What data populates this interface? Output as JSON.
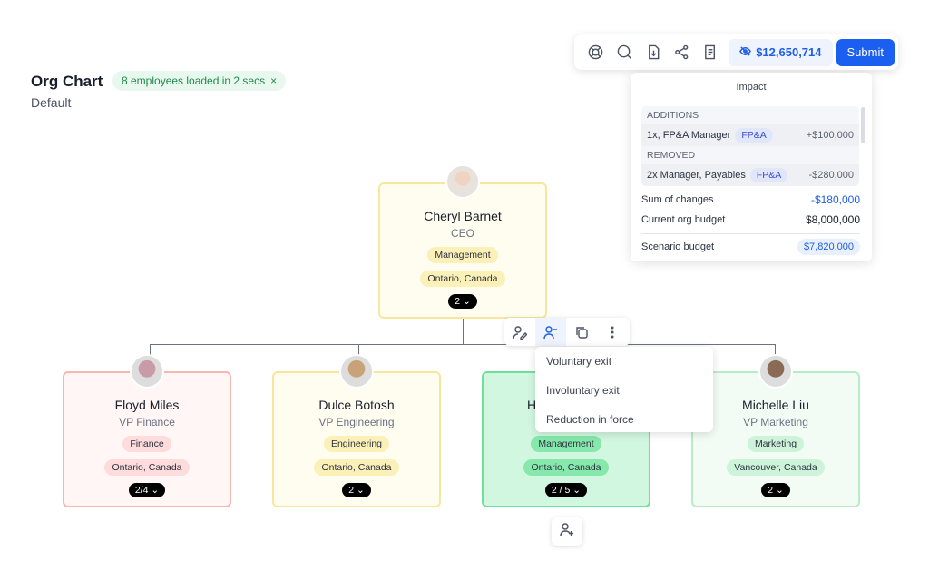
{
  "header": {
    "title": "Org Chart",
    "subtitle": "Default",
    "toast": "8 employees loaded in 2 secs",
    "toast_close": "×"
  },
  "toolbar": {
    "icons": [
      "support-icon",
      "search-icon",
      "download-icon",
      "share-icon",
      "report-icon"
    ],
    "budget": "$12,650,714",
    "submit": "Submit"
  },
  "impact": {
    "title": "Impact",
    "additions_label": "ADDITIONS",
    "additions": [
      {
        "desc": "1x, FP&A Manager",
        "chip": "FP&A",
        "amount": "+$100,000"
      }
    ],
    "removed_label": "REMOVED",
    "removed": [
      {
        "desc": "2x Manager, Payables",
        "chip": "FP&A",
        "amount": "-$280,000"
      }
    ],
    "sum_label": "Sum of changes",
    "sum": "-$180,000",
    "current_label": "Current org budget",
    "current": "$8,000,000",
    "scenario_label": "Scenario budget",
    "scenario": "$7,820,000"
  },
  "ceo": {
    "name": "Cheryl Barnet",
    "title": "CEO",
    "dept": "Management",
    "location": "Ontario, Canada",
    "count": "2"
  },
  "employees": [
    {
      "name": "Floyd Miles",
      "title": "VP Finance",
      "dept": "Finance",
      "location": "Ontario, Canada",
      "count": "2/4",
      "color": "#f4b7b4"
    },
    {
      "name": "Dulce Botosh",
      "title": "VP Engineering",
      "dept": "Engineering",
      "location": "Ontario, Canada",
      "count": "2",
      "color": "#f6e79c"
    },
    {
      "name": "H",
      "title": "",
      "dept": "Management",
      "location": "Ontario, Canada",
      "count": "2 / 5",
      "color": "#6fe09b"
    },
    {
      "name": "Michelle Liu",
      "title": "VP Marketing",
      "dept": "Marketing",
      "location": "Vancouver, Canada",
      "count": "2",
      "color": "#b8ecc9"
    }
  ],
  "menu": {
    "items": [
      "Voluntary exit",
      "Involuntary exit",
      "Reduction in force"
    ]
  },
  "colors": {
    "accent": "#1a5ff0"
  }
}
